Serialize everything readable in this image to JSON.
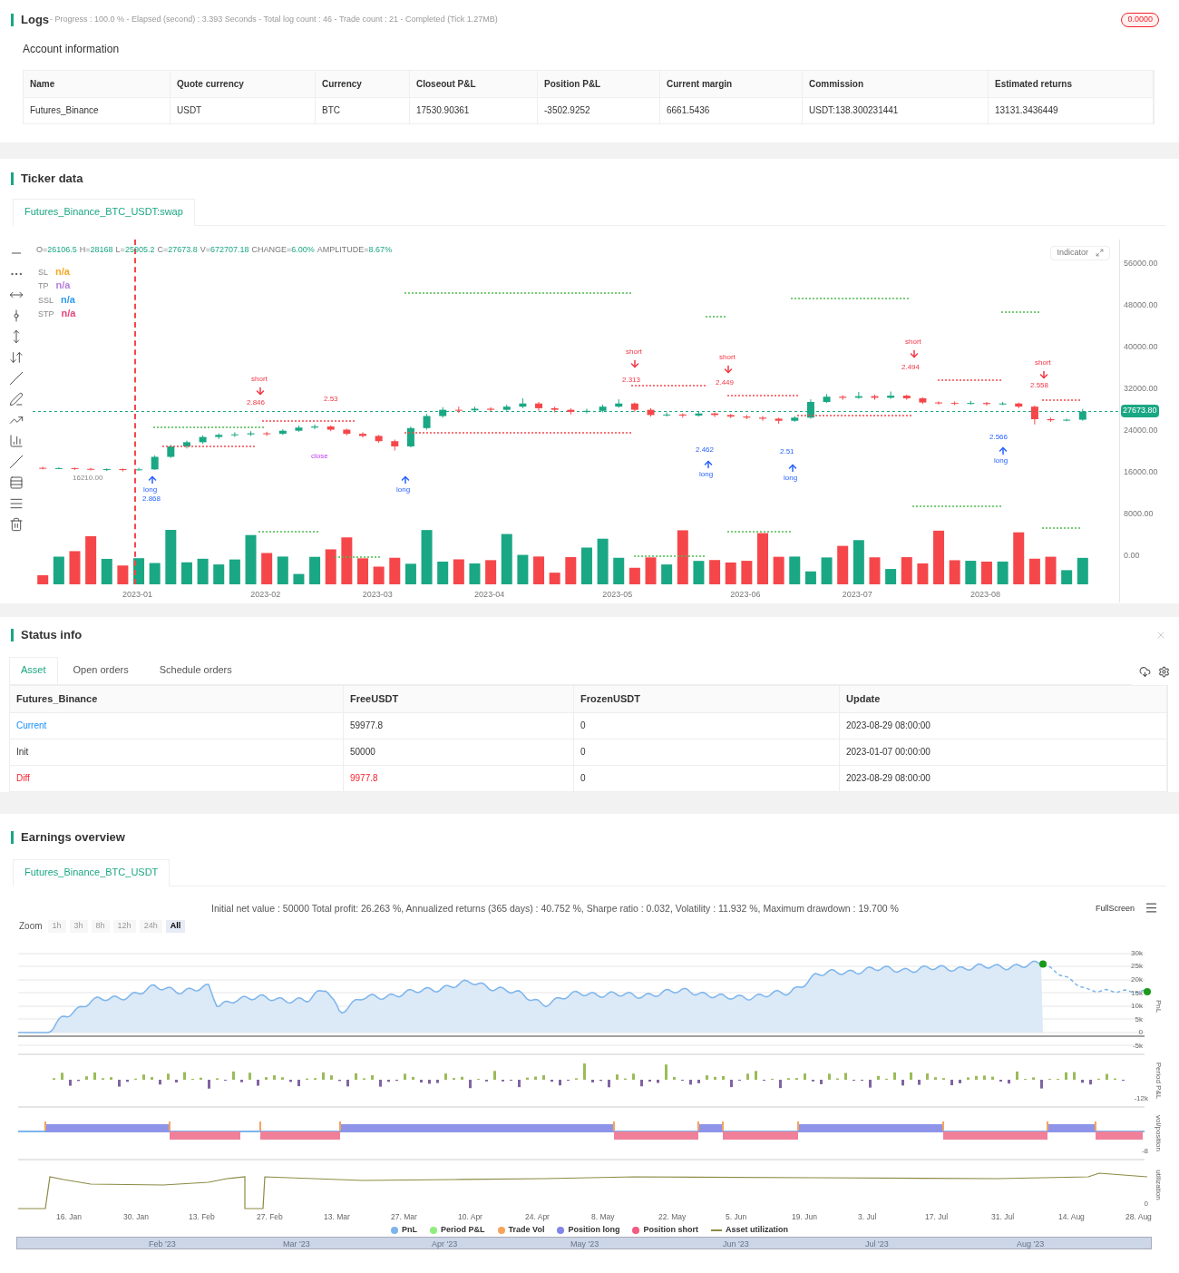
{
  "logs": {
    "title": "Logs",
    "summary": "- Progress : 100.0 % - Elapsed (second) : 3.393  Seconds - Total log count : 46 - Trade count : 21 - Completed (Tick 1.27MB)",
    "badge": "0.0000"
  },
  "account": {
    "title": "Account information",
    "columns": [
      "Name",
      "Quote currency",
      "Currency",
      "Closeout P&L",
      "Position P&L",
      "Current margin",
      "Commission",
      "Estimated returns"
    ],
    "rows": [
      [
        "Futures_Binance",
        "USDT",
        "BTC",
        "17530.90361",
        "-3502.9252",
        "6661.5436",
        "USDT:138.300231441",
        "13131.3436449"
      ]
    ]
  },
  "ticker": {
    "title": "Ticker data",
    "tabs": [
      {
        "label": "Futures_Binance_BTC_USDT:swap",
        "selected": true
      }
    ],
    "chart": {
      "ohlc": [
        {
          "label": "O=",
          "value": "26106.5"
        },
        {
          "label": "H=",
          "value": "28168"
        },
        {
          "label": "L=",
          "value": "25905.2"
        },
        {
          "label": "C=",
          "value": "27673.8"
        },
        {
          "label": "V=",
          "value": "672707.18"
        },
        {
          "label": "CHANGE=",
          "value": "6.00%"
        },
        {
          "label": "AMPLITUDE=",
          "value": "8.67%"
        }
      ],
      "legend": [
        {
          "name": "SL",
          "value": "n/a",
          "color": "#f5a623"
        },
        {
          "name": "TP",
          "value": "n/a",
          "color": "#b57edc"
        },
        {
          "name": "SSL",
          "value": "n/a",
          "color": "#2f9bf0"
        },
        {
          "name": "STP",
          "value": "n/a",
          "color": "#e8457c"
        }
      ],
      "indicator_button": "Indicator",
      "last_price": "27673.80",
      "chart_data": {
        "type": "candlestick",
        "categories": [
          null,
          null,
          null,
          null,
          null,
          null,
          "2023-01",
          null,
          null,
          null,
          null,
          null,
          null,
          null,
          "2023-02",
          null,
          null,
          null,
          null,
          null,
          null,
          "2023-03",
          null,
          null,
          null,
          null,
          null,
          null,
          "2023-04",
          null,
          null,
          null,
          null,
          null,
          null,
          null,
          "2023-05",
          null,
          null,
          null,
          null,
          null,
          null,
          null,
          "2023-06",
          null,
          null,
          null,
          null,
          null,
          null,
          "2023-07",
          null,
          null,
          null,
          null,
          null,
          null,
          null,
          "2023-08",
          null,
          null,
          null,
          null,
          null,
          null
        ],
        "ohlc": [
          [
            16900,
            17100,
            16600,
            16800
          ],
          [
            16800,
            17000,
            16700,
            16850
          ],
          [
            16850,
            16950,
            16500,
            16700
          ],
          [
            16700,
            16900,
            16400,
            16600
          ],
          [
            16600,
            16800,
            16300,
            16650
          ],
          [
            16650,
            16800,
            16210,
            16550
          ],
          [
            16550,
            16900,
            16400,
            16600
          ],
          [
            16600,
            19300,
            16500,
            19000
          ],
          [
            19000,
            21300,
            18800,
            21000
          ],
          [
            21000,
            22100,
            20600,
            21800
          ],
          [
            21800,
            23100,
            21500,
            22800
          ],
          [
            22800,
            23500,
            22400,
            23200
          ],
          [
            23200,
            23700,
            22800,
            23300
          ],
          [
            23300,
            23900,
            23000,
            23500
          ],
          [
            23500,
            23800,
            23000,
            23400
          ],
          [
            23400,
            24300,
            23200,
            24000
          ],
          [
            24000,
            25000,
            23800,
            24600
          ],
          [
            24600,
            25200,
            24300,
            24800
          ],
          [
            24800,
            25000,
            23900,
            24200
          ],
          [
            24200,
            24400,
            23100,
            23400
          ],
          [
            23400,
            23700,
            22700,
            23000
          ],
          [
            23000,
            23200,
            21700,
            22000
          ],
          [
            22000,
            22300,
            20200,
            21000
          ],
          [
            21000,
            24800,
            20800,
            24500
          ],
          [
            24500,
            27200,
            24200,
            26800
          ],
          [
            26800,
            28500,
            26500,
            28000
          ],
          [
            28000,
            28600,
            27400,
            27900
          ],
          [
            27900,
            28600,
            27600,
            28200
          ],
          [
            28200,
            28500,
            27700,
            28000
          ],
          [
            28000,
            29000,
            27800,
            28600
          ],
          [
            28600,
            30200,
            28300,
            29200
          ],
          [
            29200,
            29500,
            27800,
            28300
          ],
          [
            28300,
            28600,
            27500,
            28000
          ],
          [
            28000,
            28300,
            27100,
            27600
          ],
          [
            27600,
            28200,
            27300,
            27800
          ],
          [
            27800,
            29000,
            27500,
            28600
          ],
          [
            28600,
            30000,
            28400,
            29200
          ],
          [
            29200,
            29400,
            27600,
            28000
          ],
          [
            28000,
            28300,
            26700,
            27000
          ],
          [
            27000,
            27500,
            26700,
            27100
          ],
          [
            27100,
            27300,
            26500,
            26900
          ],
          [
            26900,
            27600,
            26700,
            27300
          ],
          [
            27300,
            27500,
            26600,
            27000
          ],
          [
            27000,
            27200,
            26400,
            26700
          ],
          [
            26700,
            27000,
            26200,
            26500
          ],
          [
            26500,
            26800,
            25900,
            26300
          ],
          [
            26300,
            26500,
            25300,
            25900
          ],
          [
            25900,
            26800,
            25700,
            26500
          ],
          [
            26500,
            30000,
            26300,
            29500
          ],
          [
            29500,
            31000,
            29300,
            30500
          ],
          [
            30500,
            30800,
            29900,
            30300
          ],
          [
            30300,
            31400,
            30100,
            30600
          ],
          [
            30600,
            30900,
            29900,
            30300
          ],
          [
            30300,
            31500,
            30100,
            30700
          ],
          [
            30700,
            30900,
            29900,
            30200
          ],
          [
            30200,
            30400,
            29100,
            29400
          ],
          [
            29400,
            29600,
            29000,
            29300
          ],
          [
            29300,
            29600,
            28900,
            29200
          ],
          [
            29200,
            29700,
            29000,
            29300
          ],
          [
            29300,
            29500,
            28800,
            29100
          ],
          [
            29100,
            29500,
            28900,
            29200
          ],
          [
            29200,
            29400,
            28300,
            28600
          ],
          [
            28600,
            28800,
            25200,
            26200
          ],
          [
            26200,
            26500,
            25700,
            26000
          ],
          [
            26000,
            26300,
            25800,
            26100
          ],
          [
            26106.5,
            28168,
            25905.2,
            27673.8
          ]
        ],
        "ylim": [
          -8850,
          60560
        ],
        "yticks": [
          {
            "value": 56000,
            "label": "56000.00"
          },
          {
            "value": 48000,
            "label": "48000.00"
          },
          {
            "value": 40000,
            "label": "40000.00"
          },
          {
            "value": 32000,
            "label": "32000.00"
          },
          {
            "value": 24000,
            "label": "24000.00"
          },
          {
            "value": 16000,
            "label": "16000.00"
          },
          {
            "value": 8000,
            "label": "8000.00"
          },
          {
            "value": 0,
            "label": "0.00"
          }
        ]
      },
      "annotations": [
        {
          "text": "short",
          "kind": "short"
        },
        {
          "text": "2.846",
          "kind": "short_value"
        },
        {
          "text": "2.53",
          "kind": "short_value"
        },
        {
          "text": "long",
          "kind": "long"
        },
        {
          "text": "2.868",
          "kind": "long_value"
        },
        {
          "text": "16210.00",
          "kind": "price"
        },
        {
          "text": "close",
          "kind": "close"
        },
        {
          "text": "long",
          "kind": "long"
        },
        {
          "text": "short",
          "kind": "short"
        },
        {
          "text": "2.313",
          "kind": "short_value"
        },
        {
          "text": "short",
          "kind": "short"
        },
        {
          "text": "2.449",
          "kind": "short_value"
        },
        {
          "text": "long",
          "kind": "long"
        },
        {
          "text": "2.462",
          "kind": "long_value"
        },
        {
          "text": "long",
          "kind": "long"
        },
        {
          "text": "2.51",
          "kind": "long_value"
        },
        {
          "text": "short",
          "kind": "short"
        },
        {
          "text": "2.494",
          "kind": "short_value"
        },
        {
          "text": "short",
          "kind": "short"
        },
        {
          "text": "2.558",
          "kind": "short_value"
        },
        {
          "text": "long",
          "kind": "long"
        },
        {
          "text": "2.566",
          "kind": "long_value"
        }
      ]
    }
  },
  "status": {
    "title": "Status info",
    "tabs": [
      {
        "label": "Asset",
        "selected": true
      },
      {
        "label": "Open orders",
        "selected": false
      },
      {
        "label": "Schedule orders",
        "selected": false
      }
    ],
    "columns": [
      "Futures_Binance",
      "FreeUSDT",
      "FrozenUSDT",
      "Update"
    ],
    "rows": [
      [
        {
          "text": "Current",
          "color": "#1890ff"
        },
        {
          "text": "59977.8"
        },
        {
          "text": "0"
        },
        {
          "text": "2023-08-29 08:00:00"
        }
      ],
      [
        {
          "text": "Init"
        },
        {
          "text": "50000"
        },
        {
          "text": "0"
        },
        {
          "text": "2023-01-07 00:00:00"
        }
      ],
      [
        {
          "text": "Diff",
          "color": "#f5222d"
        },
        {
          "text": "9977.8",
          "color": "#f5222d"
        },
        {
          "text": "0"
        },
        {
          "text": "2023-08-29 08:00:00"
        }
      ]
    ]
  },
  "earnings": {
    "title": "Earnings overview",
    "tabs": [
      {
        "label": "Futures_Binance_BTC_USDT",
        "selected": true
      }
    ],
    "summary": "Initial net value : 50000 Total profit: 26.263 %, Annualized returns (365 days) : 40.752 %, Sharpe ratio : 0.032, Volatility : 11.932 %, Maximum drawdown : 19.700 %",
    "fullscreen": "FullScreen",
    "zoom_label": "Zoom",
    "zoom_buttons": [
      {
        "label": "1h",
        "selected": false
      },
      {
        "label": "3h",
        "selected": false
      },
      {
        "label": "8h",
        "selected": false
      },
      {
        "label": "12h",
        "selected": false
      },
      {
        "label": "24h",
        "selected": false
      },
      {
        "label": "All",
        "selected": true
      }
    ],
    "pnl_ticks": [
      "30k",
      "25k",
      "20k",
      "15k",
      "10k",
      "5k",
      "0",
      "-5k"
    ],
    "period_ticks": [
      "-12k"
    ],
    "vol_ticks": [
      "-8"
    ],
    "util_ticks": [
      "0"
    ],
    "axis_titles": [
      "PnL",
      "Period P&L",
      "vol/position",
      "utilization"
    ],
    "dates": [
      "16. Jan",
      "30. Jan",
      "13. Feb",
      "27. Feb",
      "13. Mar",
      "27. Mar",
      "10. Apr",
      "24. Apr",
      "8. May",
      "22. May",
      "5. Jun",
      "19. Jun",
      "3. Jul",
      "17. Jul",
      "31. Jul",
      "14. Aug",
      "28. Aug"
    ],
    "legend": [
      {
        "label": "PnL",
        "color": "#7cb5ec",
        "kind": "dot"
      },
      {
        "label": "Period P&L",
        "color": "#90ed7d",
        "kind": "dot"
      },
      {
        "label": "Trade Vol",
        "color": "#f7a35c",
        "kind": "dot"
      },
      {
        "label": "Position long",
        "color": "#8085e9",
        "kind": "dot"
      },
      {
        "label": "Position short",
        "color": "#f15c80",
        "kind": "dot"
      },
      {
        "label": "Asset utilization",
        "color": "#8d8a45",
        "kind": "line"
      }
    ],
    "navigator_months": [
      "Feb '23",
      "Mar '23",
      "Apr '23",
      "May '23",
      "Jun '23",
      "Jul '23",
      "Aug '23"
    ]
  }
}
